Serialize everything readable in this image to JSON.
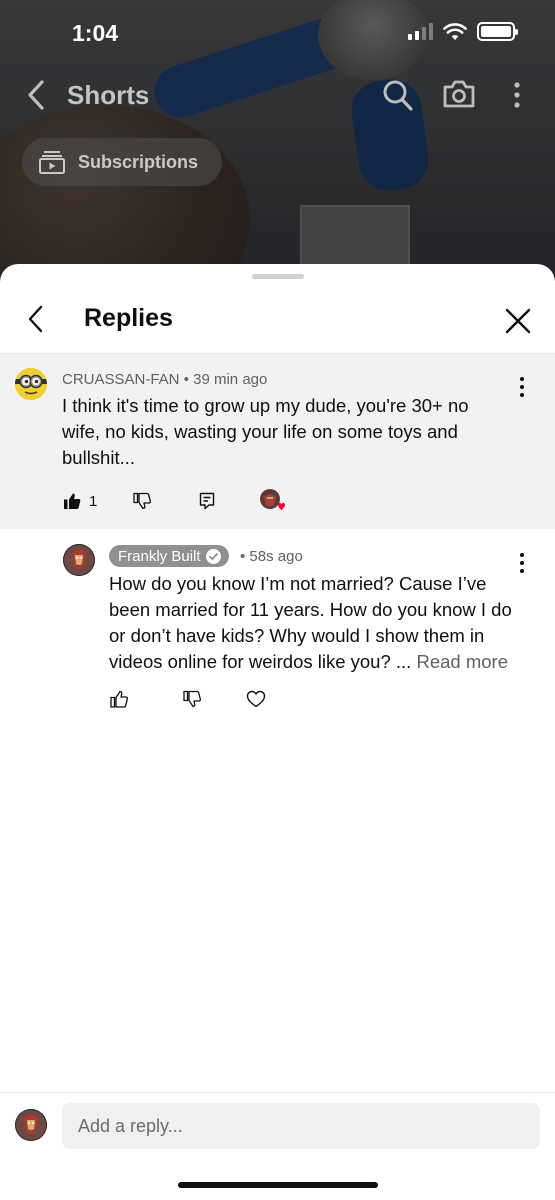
{
  "status_bar": {
    "time": "1:04"
  },
  "top_nav": {
    "title": "Shorts",
    "chip_label": "Subscriptions"
  },
  "sheet": {
    "title": "Replies"
  },
  "parent_comment": {
    "author": "CRUASSAN-FAN",
    "age": "39 min ago",
    "text": "I think it's time to grow up my dude, you're 30+ no wife, no kids, wasting your life on some toys and bullshit...",
    "like_count": "1"
  },
  "reply": {
    "author": "Frankly Built",
    "age": "58s ago",
    "text": "How do you know I’m not married? Cause I’ve been married for 11 years. How do you know I do or don’t have kids? Why would I show them in videos online for weirdos like you? ...",
    "read_more": "Read more"
  },
  "composer": {
    "placeholder": "Add a reply..."
  },
  "colors": {
    "heart": "#ff0033",
    "meta": "#606060",
    "sheet_bg": "#ffffff",
    "parent_bg": "#f2f2f2"
  },
  "icons": [
    "back-chevron-icon",
    "search-icon",
    "camera-icon",
    "more-vert-icon",
    "subscriptions-icon",
    "close-icon",
    "thumbs-up-icon",
    "thumbs-down-icon",
    "reply-icon",
    "heart-icon",
    "verified-check-icon"
  ]
}
